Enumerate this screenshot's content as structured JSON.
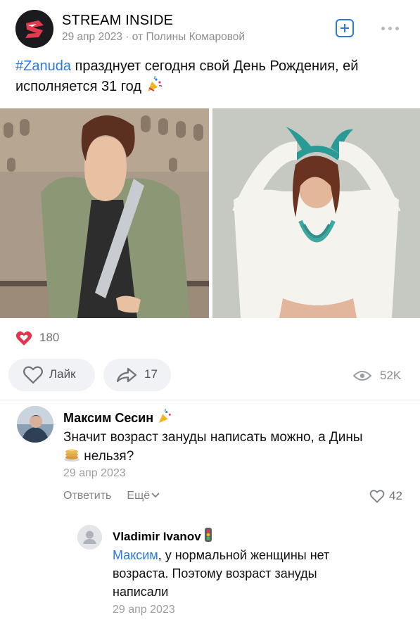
{
  "post": {
    "author": "STREAM INSIDE",
    "date": "29 апр 2023",
    "meta_separator": " · ",
    "byline": "от Полины Комаровой",
    "hashtag": "#Zanuda",
    "text_part1": " празднует сегодня свой День Рождения, ей",
    "text_part2": "исполняется 31 год",
    "emoji_icon": "party-popper-icon",
    "images": [
      "photo-woman-green-coat-colosseum",
      "photo-woman-white-blouse-horns"
    ]
  },
  "stats": {
    "likes": "180",
    "like_label": "Лайк",
    "shares": "17",
    "views": "52K"
  },
  "comments": [
    {
      "author": "Максим Сесин",
      "text_part1": "Значит возраст зануды написать можно, а Дины",
      "text_part2": "нельзя?",
      "date": "29 апр 2023",
      "reply_label": "Ответить",
      "more_label": "Ещё",
      "likes": "42"
    },
    {
      "author": "Vladimir Ivanov",
      "mention": "Максим",
      "text_part1": ", у нормальной женщины нет",
      "text_part2": "возраста. Поэтому возраст зануды",
      "text_part3": "написали",
      "date": "29 апр 2023"
    }
  ],
  "colors": {
    "accent": "#2a79e0",
    "like_red": "#e3334e",
    "muted": "#8a8d91"
  }
}
